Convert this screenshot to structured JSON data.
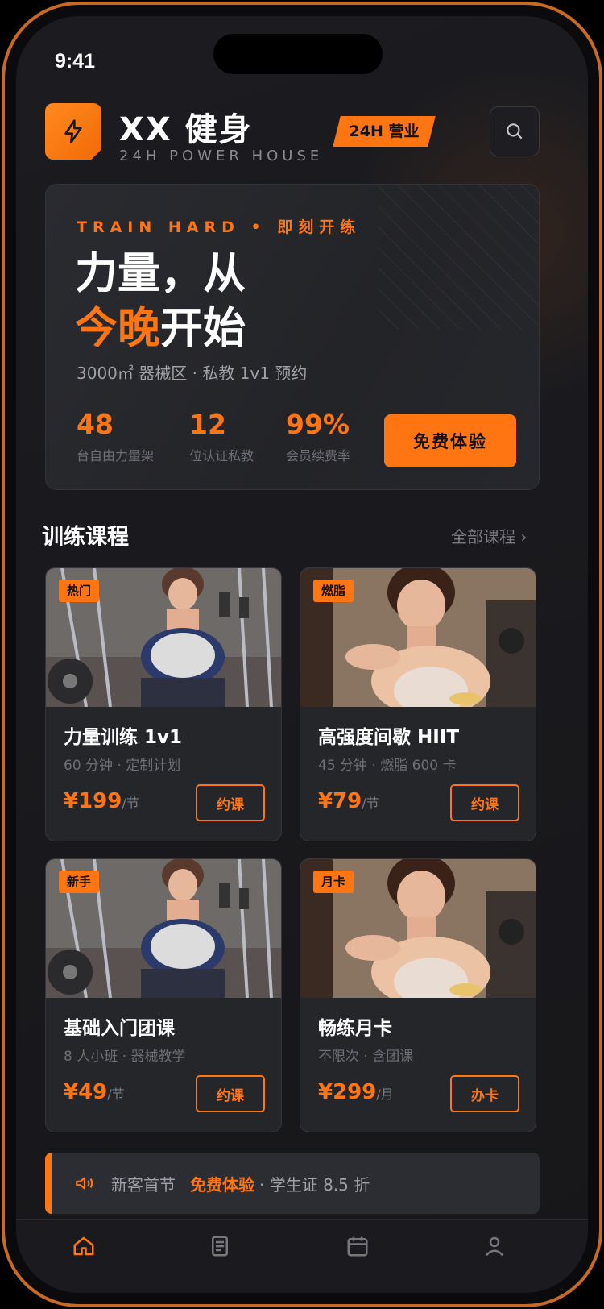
{
  "status_bar": {
    "time": "9:41"
  },
  "header": {
    "brand": "XX 健身",
    "brand_sub": "24H POWER HOUSE",
    "badge": "24H 营业",
    "search_icon": "search-icon"
  },
  "hero": {
    "tagline": "TRAIN HARD • 即刻开练",
    "headline_1": "力量，从",
    "headline_2_highlight": "今晚",
    "headline_2_rest": "开始",
    "subtitle": "3000㎡ 器械区 · 私教 1v1 预约",
    "stats": [
      {
        "value": "48",
        "label": "台自由力量架"
      },
      {
        "value": "12",
        "label": "位认证私教"
      },
      {
        "value": "99%",
        "label": "会员续费率"
      }
    ],
    "cta": "免费体验"
  },
  "courses": {
    "title": "训练课程",
    "more": "全部课程 ›",
    "items": [
      {
        "tag": "热门",
        "title": "力量训练 1v1",
        "sub": "60 分钟 · 定制计划",
        "price": "¥199",
        "unit": "/节",
        "action": "约课"
      },
      {
        "tag": "燃脂",
        "title": "高强度间歇 HIIT",
        "sub": "45 分钟 · 燃脂 600 卡",
        "price": "¥79",
        "unit": "/节",
        "action": "约课"
      },
      {
        "tag": "新手",
        "title": "基础入门团课",
        "sub": "8 人小班 · 器械教学",
        "price": "¥49",
        "unit": "/节",
        "action": "约课"
      },
      {
        "tag": "月卡",
        "title": "畅练月卡",
        "sub": "不限次 · 含团课",
        "price": "¥299",
        "unit": "/月",
        "action": "办卡"
      }
    ]
  },
  "promo": {
    "icon": "megaphone-icon",
    "text_a": "新客首节",
    "text_b": "免费体验",
    "text_c": "· 学生证 8.5 折"
  },
  "tabbar": {
    "icons": [
      "home-icon",
      "list-icon",
      "calendar-icon",
      "user-icon"
    ]
  },
  "colors": {
    "accent": "#ff7512",
    "bg": "#1a1a1e",
    "card": "#25262a"
  }
}
